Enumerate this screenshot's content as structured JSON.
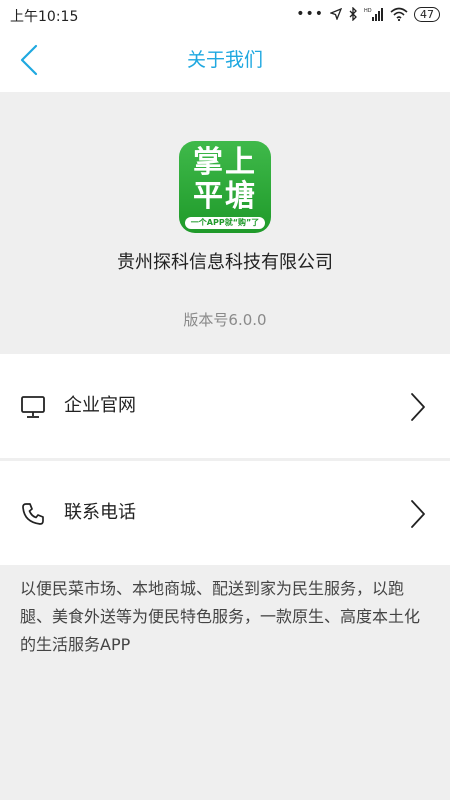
{
  "status_bar": {
    "time": "上午10:15",
    "battery": "47",
    "icons": [
      "more-dots-icon",
      "location-icon",
      "bluetooth-icon",
      "hd-signal-icon",
      "wifi-icon",
      "battery-icon"
    ]
  },
  "nav": {
    "title": "关于我们",
    "back_icon": "back-chevron-icon"
  },
  "app": {
    "icon_line1": "掌上",
    "icon_line2": "平塘",
    "icon_slogan": "一个APP就“购”了",
    "company": "贵州探科信息科技有限公司",
    "version": "版本号6.0.0"
  },
  "menu": [
    {
      "label": "企业官网",
      "icon": "monitor-icon"
    },
    {
      "label": "联系电话",
      "icon": "phone-icon"
    }
  ],
  "description": "以便民菜市场、本地商城、配送到家为民生服务，以跑腿、美食外送等为便民特色服务，一款原生、高度本土化的生活服务APP",
  "colors": {
    "accent": "#1fa8e0",
    "app_green": "#2aa836",
    "background": "#efefef"
  }
}
